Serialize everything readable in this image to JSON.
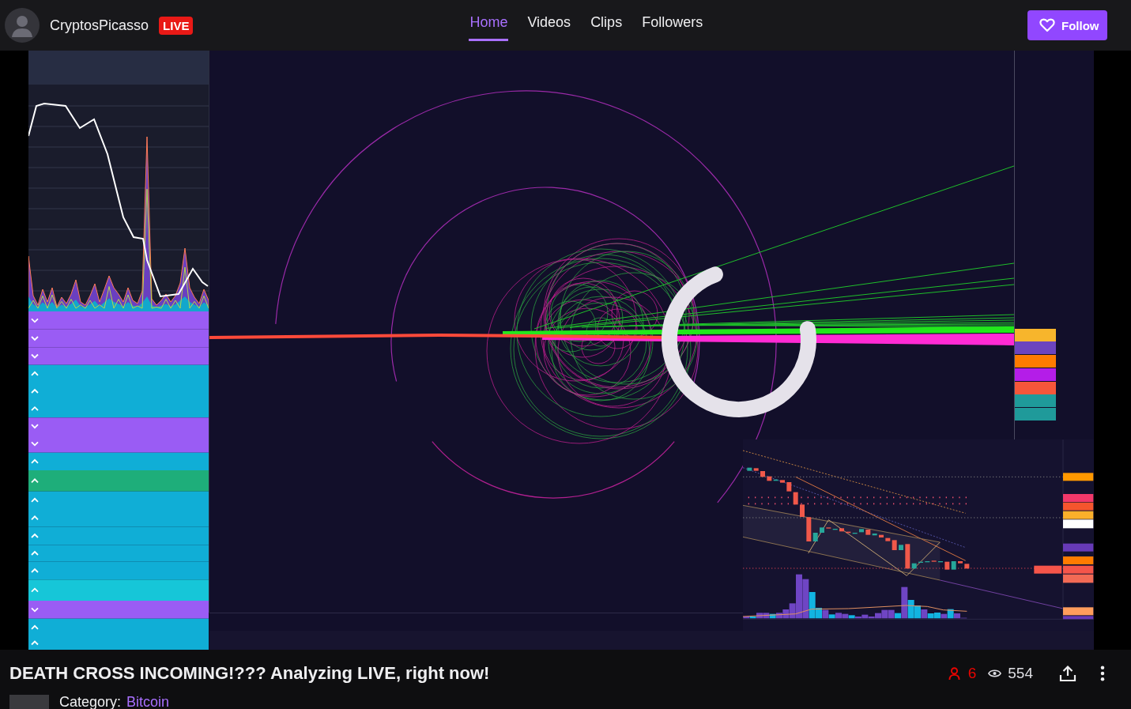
{
  "channel": {
    "name": "CryptosPicasso",
    "badge": "LIVE"
  },
  "nav": [
    {
      "label": "Home",
      "selected": true
    },
    {
      "label": "Videos",
      "selected": false
    },
    {
      "label": "Clips",
      "selected": false
    },
    {
      "label": "Followers",
      "selected": false
    }
  ],
  "follow_button": {
    "label": "Follow"
  },
  "stream": {
    "title": "DEATH CROSS INCOMING!??? Analyzing LIVE, right now!",
    "live_viewers": "6",
    "views": "554",
    "category_label": "Category:",
    "category": "Bitcoin"
  }
}
